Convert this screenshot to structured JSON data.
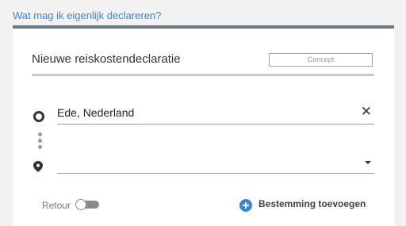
{
  "help": {
    "link_label": "Wat mag ik eigenlijk declareren?"
  },
  "form": {
    "title": "Nieuwe reiskostendeclaratie",
    "status": "Concept",
    "origin": {
      "value": "Ede, Nederland",
      "icon": "circle-origin-icon",
      "clear_icon": "close-icon",
      "clear_glyph": "✕"
    },
    "destination": {
      "value": "",
      "icon": "map-pin-icon",
      "dropdown_icon": "caret-down-icon"
    },
    "retour": {
      "label": "Retour",
      "checked": false
    },
    "add_destination": {
      "label": "Bestemming toevoegen",
      "icon": "plus-circle-icon"
    }
  },
  "colors": {
    "accent": "#3a86d4",
    "card_border": "#6b7a86",
    "background": "#f2f2f2"
  }
}
